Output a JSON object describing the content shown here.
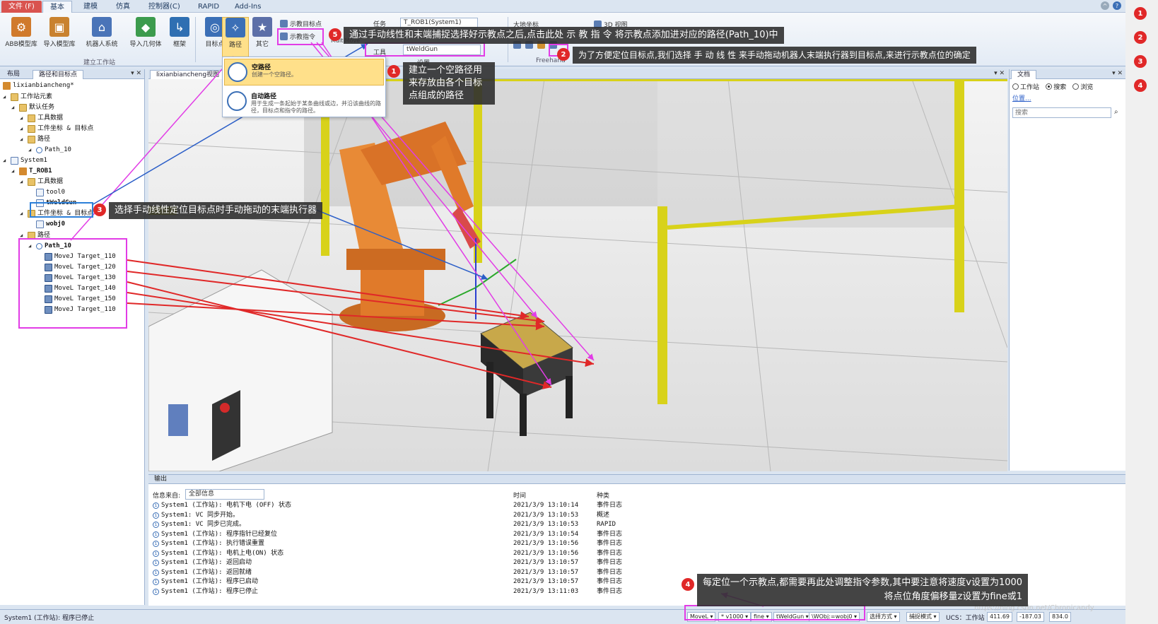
{
  "ribbon": {
    "tabs": [
      "文件 (F)",
      "基本",
      "建模",
      "仿真",
      "控制器(C)",
      "RAPID",
      "Add-Ins"
    ],
    "buttons": [
      {
        "label": "ABB模型库",
        "color": "#d07a2c"
      },
      {
        "label": "导入模型库",
        "color": "#c9822f"
      },
      {
        "label": "机器人系统",
        "color": "#4a74b8"
      },
      {
        "label": "导入几何体",
        "color": "#3c9b4d"
      },
      {
        "label": "框架",
        "color": "#2f6fb2"
      },
      {
        "label": "目标点",
        "color": "#3b6fb6"
      },
      {
        "label": "路径",
        "color": "#3b6fb6"
      },
      {
        "label": "其它",
        "color": "#5c6fa8"
      }
    ],
    "group_build": "建立工作站",
    "teach_target": "示教目标点",
    "teach_instruction": "示教指令",
    "multimove": "MultiMove",
    "task_label": "任务",
    "task_value": "T_ROB1(System1)",
    "tool_label": "工具",
    "tool_value": "tWeldGun",
    "freehand": "Freehand",
    "view_3d": "3D 视图",
    "small_label": "大地坐标",
    "settings_label": "设置"
  },
  "left_panel": {
    "tabs": [
      "布局",
      "路径和目标点"
    ],
    "station": "lixianbiancheng*",
    "tree": [
      {
        "text": "工作站元素",
        "icon": "folder",
        "level": 0
      },
      {
        "text": "默认任务",
        "icon": "folder",
        "level": 1
      },
      {
        "text": "工具数据",
        "icon": "folder",
        "level": 2
      },
      {
        "text": "工件坐标 & 目标点",
        "icon": "folder",
        "level": 2
      },
      {
        "text": "路径",
        "icon": "folder",
        "level": 2
      },
      {
        "text": "Path_10",
        "icon": "path",
        "level": 3
      },
      {
        "text": "System1",
        "icon": "doc",
        "level": 0
      },
      {
        "text": "T_ROB1",
        "icon": "robot",
        "level": 1,
        "bold": true
      },
      {
        "text": "工具数据",
        "icon": "folder",
        "level": 2
      },
      {
        "text": "tool0",
        "icon": "doc",
        "level": 3
      },
      {
        "text": "tWeldGun",
        "icon": "doc",
        "level": 3,
        "bold": true
      },
      {
        "text": "工件坐标 & 目标点",
        "icon": "folder",
        "level": 2
      },
      {
        "text": "wobj0",
        "icon": "doc",
        "level": 3,
        "bold": true
      },
      {
        "text": "路径",
        "icon": "folder",
        "level": 2
      },
      {
        "text": "Path_10",
        "icon": "path",
        "level": 3,
        "bold": true
      },
      {
        "text": "MoveJ Target_110",
        "icon": "target",
        "level": 4
      },
      {
        "text": "MoveL Target_120",
        "icon": "target",
        "level": 4
      },
      {
        "text": "MoveL Target_130",
        "icon": "target",
        "level": 4
      },
      {
        "text": "MoveL Target_140",
        "icon": "target",
        "level": 4
      },
      {
        "text": "MoveL Target_150",
        "icon": "target",
        "level": 4
      },
      {
        "text": "MoveJ Target_110",
        "icon": "target",
        "level": 4
      }
    ]
  },
  "viewport": {
    "tab_label": "lixianbiancheng视图"
  },
  "newpath_menu": {
    "empty_title": "空路径",
    "empty_desc": "创建一个空路径。",
    "auto_title": "自动路径",
    "auto_desc": "用于生成一条起始于某条曲线或边，并沿该曲线的路径，目标点和指令的路径。"
  },
  "right_panel": {
    "title": "文档",
    "radio_station": "工作站",
    "radio_search": "搜索",
    "radio_browse": "浏览",
    "location": "位置...",
    "search_placeholder": "搜索"
  },
  "output": {
    "title": "输出",
    "filter_label": "信息来自:",
    "filter_value": "全部信息",
    "col_time": "时间",
    "col_type": "种类",
    "rows": [
      {
        "msg": "System1 (工作站): 电机下电 (OFF) 状态",
        "time": "2021/3/9 13:10:14",
        "type": "事件日志"
      },
      {
        "msg": "System1: VC 同步开始。",
        "time": "2021/3/9 13:10:53",
        "type": "概述"
      },
      {
        "msg": "System1: VC 同步已完成。",
        "time": "2021/3/9 13:10:53",
        "type": "RAPID"
      },
      {
        "msg": "System1 (工作站): 程序指针已经复位",
        "time": "2021/3/9 13:10:54",
        "type": "事件日志"
      },
      {
        "msg": "System1 (工作站): 执行错误重置",
        "time": "2021/3/9 13:10:56",
        "type": "事件日志"
      },
      {
        "msg": "System1 (工作站): 电机上电(ON) 状态",
        "time": "2021/3/9 13:10:56",
        "type": "事件日志"
      },
      {
        "msg": "System1 (工作站): 返回启动",
        "time": "2021/3/9 13:10:57",
        "type": "事件日志"
      },
      {
        "msg": "System1 (工作站): 返回就绪",
        "time": "2021/3/9 13:10:57",
        "type": "事件日志"
      },
      {
        "msg": "System1 (工作站): 程序已启动",
        "time": "2021/3/9 13:10:57",
        "type": "事件日志"
      },
      {
        "msg": "System1 (工作站): 程序已停止",
        "time": "2021/3/9 13:11:03",
        "type": "事件日志"
      }
    ]
  },
  "statusbar": {
    "status": "System1 (工作站): 程序已停止",
    "instr": "MoveL ▾",
    "speed": "* v1000 ▾",
    "zone": "fine ▾",
    "tool": "tWeldGun ▾",
    "wobj": "\\WObj:=wobj0 ▾",
    "select_mode": "选择方式 ▾",
    "snap_mode": "捕捉模式 ▾",
    "ucs": "UCS：工作站",
    "coord1": "411.69",
    "coord2": "-187.03",
    "coord3": "834.0",
    "watermark": "https://blog.csdn.net/Chronicandy"
  },
  "annotations": {
    "n1_num": "1",
    "n1": "建立一个空路径用来存放由各个目标点组成的路径",
    "n2_num": "2",
    "n2": "为了方便定位目标点,我们选择 手 动 线 性 来手动拖动机器人末端执行器到目标点,来进行示教点位的确定",
    "n3_num": "3",
    "n3": "选择手动线性定位目标点时手动拖动的末端执行器",
    "n4_num": "4",
    "n4_line1": "每定位一个示教点,都需要再此处调整指令参数,其中要注意将速度v设置为1000",
    "n4_line2": "将点位角度偏移量z设置为fine或1",
    "n5_num": "5",
    "n5": "通过手动线性和末端捕捉选择好示教点之后,点击此处 示 教 指 令 将示教点添加进对应的路径(Path_10)中"
  },
  "gutter": [
    "1",
    "2",
    "3",
    "4"
  ],
  "colors": {
    "magenta": "#e23ce6",
    "red_arrow": "#e02828",
    "blue_arrow": "#2c5fc8",
    "robot": "#e07a2a",
    "fence": "#d8d21a"
  }
}
